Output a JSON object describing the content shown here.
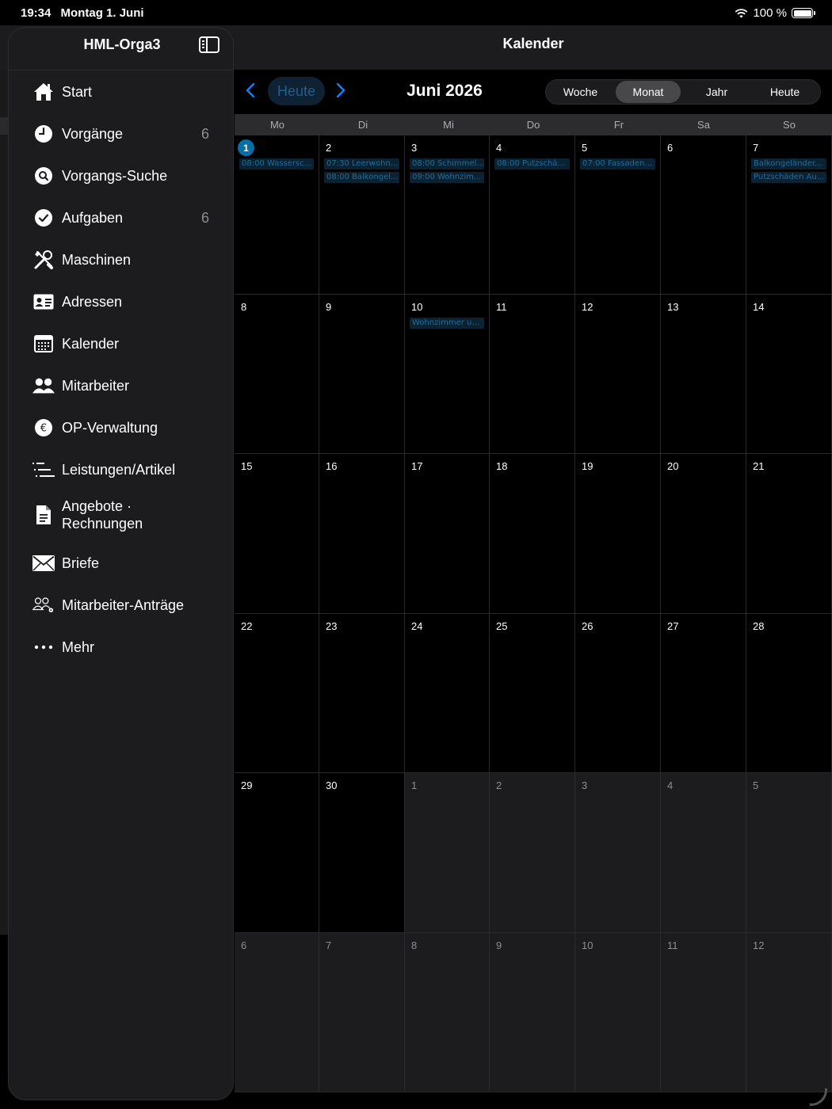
{
  "status_bar": {
    "time": "19:34",
    "date": "Montag 1. Juni",
    "battery": "100 %",
    "battery_level": 1.0
  },
  "header": {
    "app_title": "HML-Orga3",
    "page_title": "Kalender"
  },
  "sidebar": {
    "items": [
      {
        "label": "Start",
        "icon": "house-icon",
        "badge": ""
      },
      {
        "label": "Vorgänge",
        "icon": "clock-icon",
        "badge": "6"
      },
      {
        "label": "Vorgangs-Suche",
        "icon": "search-circle-icon",
        "badge": ""
      },
      {
        "label": "Aufgaben",
        "icon": "checkmark-circle-icon",
        "badge": "6"
      },
      {
        "label": "Maschinen",
        "icon": "tools-icon",
        "badge": ""
      },
      {
        "label": "Adressen",
        "icon": "contact-card-icon",
        "badge": ""
      },
      {
        "label": "Kalender",
        "icon": "calendar-icon",
        "badge": ""
      },
      {
        "label": "Mitarbeiter",
        "icon": "people-icon",
        "badge": ""
      },
      {
        "label": "OP-Verwaltung",
        "icon": "euro-circle-icon",
        "badge": ""
      },
      {
        "label": "Leistungen/Artikel",
        "icon": "list-icon",
        "badge": ""
      },
      {
        "label": "Angebote ·\nRechnungen",
        "label_line1": "Angebote ·",
        "label_line2": "Rechnungen",
        "icon": "document-icon",
        "badge": ""
      },
      {
        "label": "Briefe",
        "icon": "envelope-icon",
        "badge": ""
      },
      {
        "label": "Mitarbeiter-Anträge",
        "icon": "people-gear-icon",
        "badge": ""
      },
      {
        "label": "Mehr",
        "icon": "ellipsis-icon",
        "badge": ""
      }
    ]
  },
  "calendar": {
    "today_button": "Heute",
    "month_title": "Juni 2026",
    "views": [
      "Woche",
      "Monat",
      "Jahr",
      "Heute"
    ],
    "active_view": "Monat",
    "weekdays": [
      "Mo",
      "Di",
      "Mi",
      "Do",
      "Fr",
      "Sa",
      "So"
    ],
    "weeks": [
      [
        {
          "day": "1",
          "today": true,
          "events": [
            "08:00 Wassersc..."
          ]
        },
        {
          "day": "2",
          "events": [
            "07:30 Leerwohn...",
            "08:00 Balkongel..."
          ]
        },
        {
          "day": "3",
          "events": [
            "08:00 Schimmel...",
            "09:00 Wohnzim..."
          ]
        },
        {
          "day": "4",
          "events": [
            "08:00 Putzschä..."
          ]
        },
        {
          "day": "5",
          "events": [
            "07:00 Fassadena..."
          ]
        },
        {
          "day": "6",
          "events": []
        },
        {
          "day": "7",
          "events": [
            "Balkongeländer...",
            "Putzschäden Au..."
          ]
        }
      ],
      [
        {
          "day": "8",
          "events": []
        },
        {
          "day": "9",
          "events": []
        },
        {
          "day": "10",
          "events": [
            "Wohnzimmer un..."
          ]
        },
        {
          "day": "11",
          "events": []
        },
        {
          "day": "12",
          "events": []
        },
        {
          "day": "13",
          "events": []
        },
        {
          "day": "14",
          "events": []
        }
      ],
      [
        {
          "day": "15",
          "events": []
        },
        {
          "day": "16",
          "events": []
        },
        {
          "day": "17",
          "events": []
        },
        {
          "day": "18",
          "events": []
        },
        {
          "day": "19",
          "events": []
        },
        {
          "day": "20",
          "events": []
        },
        {
          "day": "21",
          "events": []
        }
      ],
      [
        {
          "day": "22",
          "events": []
        },
        {
          "day": "23",
          "events": []
        },
        {
          "day": "24",
          "events": []
        },
        {
          "day": "25",
          "events": []
        },
        {
          "day": "26",
          "events": []
        },
        {
          "day": "27",
          "events": []
        },
        {
          "day": "28",
          "events": []
        }
      ],
      [
        {
          "day": "29",
          "events": []
        },
        {
          "day": "30",
          "events": []
        },
        {
          "day": "1",
          "other": true,
          "events": []
        },
        {
          "day": "2",
          "other": true,
          "events": []
        },
        {
          "day": "3",
          "other": true,
          "events": []
        },
        {
          "day": "4",
          "other": true,
          "events": []
        },
        {
          "day": "5",
          "other": true,
          "events": []
        }
      ],
      [
        {
          "day": "6",
          "other": true,
          "events": []
        },
        {
          "day": "7",
          "other": true,
          "events": []
        },
        {
          "day": "8",
          "other": true,
          "events": []
        },
        {
          "day": "9",
          "other": true,
          "events": []
        },
        {
          "day": "10",
          "other": true,
          "events": []
        },
        {
          "day": "11",
          "other": true,
          "events": []
        },
        {
          "day": "12",
          "other": true,
          "events": []
        }
      ]
    ]
  },
  "colors": {
    "accent": "#0a84ff",
    "today_circle": "#0a6ea6",
    "event_bg": "#0b2233",
    "event_text": "#1f6e9c"
  }
}
